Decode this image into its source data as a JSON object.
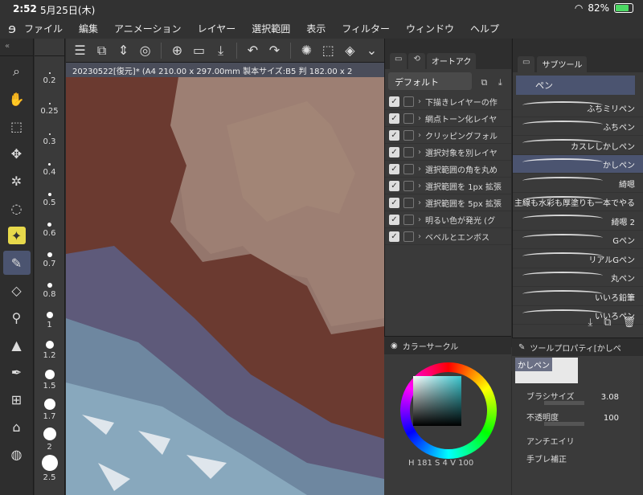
{
  "status": {
    "time": "2:52",
    "date": "5月25日(木)",
    "battery": "82%",
    "battery_level": 0.82
  },
  "menu": {
    "items": [
      "ファイル",
      "編集",
      "アニメーション",
      "レイヤー",
      "選択範囲",
      "表示",
      "フィルター",
      "ウィンドウ",
      "ヘルプ"
    ]
  },
  "canvas": {
    "tab_title": "20230522[復元]* (A4 210.00 x 297.00mm 製本サイズ:B5 判 182.00 x 2"
  },
  "brush_sizes": [
    "0.2",
    "0.25",
    "0.3",
    "0.4",
    "0.5",
    "0.6",
    "0.7",
    "0.8",
    "1",
    "1.2",
    "1.5",
    "1.7",
    "2",
    "2.5"
  ],
  "auto_action": {
    "tab_label": "オートアク",
    "set_name": "デフォルト",
    "items": [
      "下描きレイヤーの作",
      "網点トーン化レイヤ",
      "クリッピングフォル",
      "選択対象を別レイヤ",
      "選択範囲の角を丸め",
      "選択範囲を 1px 拡張",
      "選択範囲を 5px 拡張",
      "明るい色が発光 (グ",
      "ベベルとエンボス"
    ]
  },
  "color_circle": {
    "title": "カラーサークル",
    "h": "181",
    "s": "4",
    "v": "100",
    "h_label": "H",
    "s_label": "S",
    "v_label": "V"
  },
  "sub_tool": {
    "tab_label": "サブツール",
    "group": "ペン",
    "brushes": [
      "ふちミリペン",
      "ふちペン",
      "カスレしかしペン",
      "かしペン",
      "綺嗯",
      "主線も水彩も厚塗りも一本でやる",
      "綺嗯 2",
      "Gペン",
      "リアルGペン",
      "丸ペン",
      "いいろ鉛筆",
      "いいろペン"
    ],
    "selected_index": 3
  },
  "tool_property": {
    "title": "ツールプロパティ[かしペ",
    "preview_label": "かしペン",
    "brush_size_label": "ブラシサイズ",
    "brush_size_value": "3.08",
    "opacity_label": "不透明度",
    "opacity_value": "100",
    "antialias_label": "アンチエイリ",
    "stabilization_label": "手ブレ補正"
  }
}
